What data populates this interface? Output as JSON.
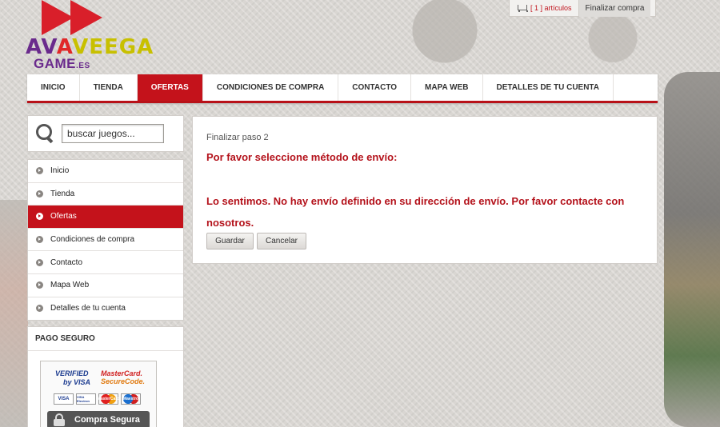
{
  "logo": {
    "wordmark_part1": "AV",
    "wordmark_part2": "A",
    "wordmark_part3": "VEEGA",
    "sub": "GAME",
    "sub_suffix": ".ES"
  },
  "cart": {
    "count": "[ 1 ] artículos",
    "checkout_label": "Finalizar compra"
  },
  "nav": {
    "items": [
      "INICIO",
      "TIENDA",
      "OFERTAS",
      "CONDICIONES DE COMPRA",
      "CONTACTO",
      "MAPA WEB",
      "DETALLES DE TU CUENTA"
    ],
    "active_index": 2
  },
  "search": {
    "placeholder": "buscar juegos..."
  },
  "sidebar": {
    "items": [
      "Inicio",
      "Tienda",
      "Ofertas",
      "Condiciones de compra",
      "Contacto",
      "Mapa Web",
      "Detalles de tu cuenta"
    ],
    "active_index": 2
  },
  "secure": {
    "title": "PAGO SEGURO",
    "vbv_line1": "VERIFIED",
    "vbv_line2": "by VISA",
    "msc_line1": "MasterCard.",
    "msc_line2": "SecureCode.",
    "cards": [
      "VISA",
      "VISA Electron",
      "MasterCard",
      "Maestro"
    ],
    "lock_label": "Compra Segura"
  },
  "main": {
    "step": "Finalizar paso 2",
    "shipping_title": "Por favor seleccione método de envío:",
    "error": "Lo sentimos. No hay envío definido en su dirección de envío. Por favor contacte con nosotros.",
    "save_label": "Guardar",
    "cancel_label": "Cancelar"
  },
  "colors": {
    "accent": "#c4121b",
    "error_text": "#b4121b"
  }
}
